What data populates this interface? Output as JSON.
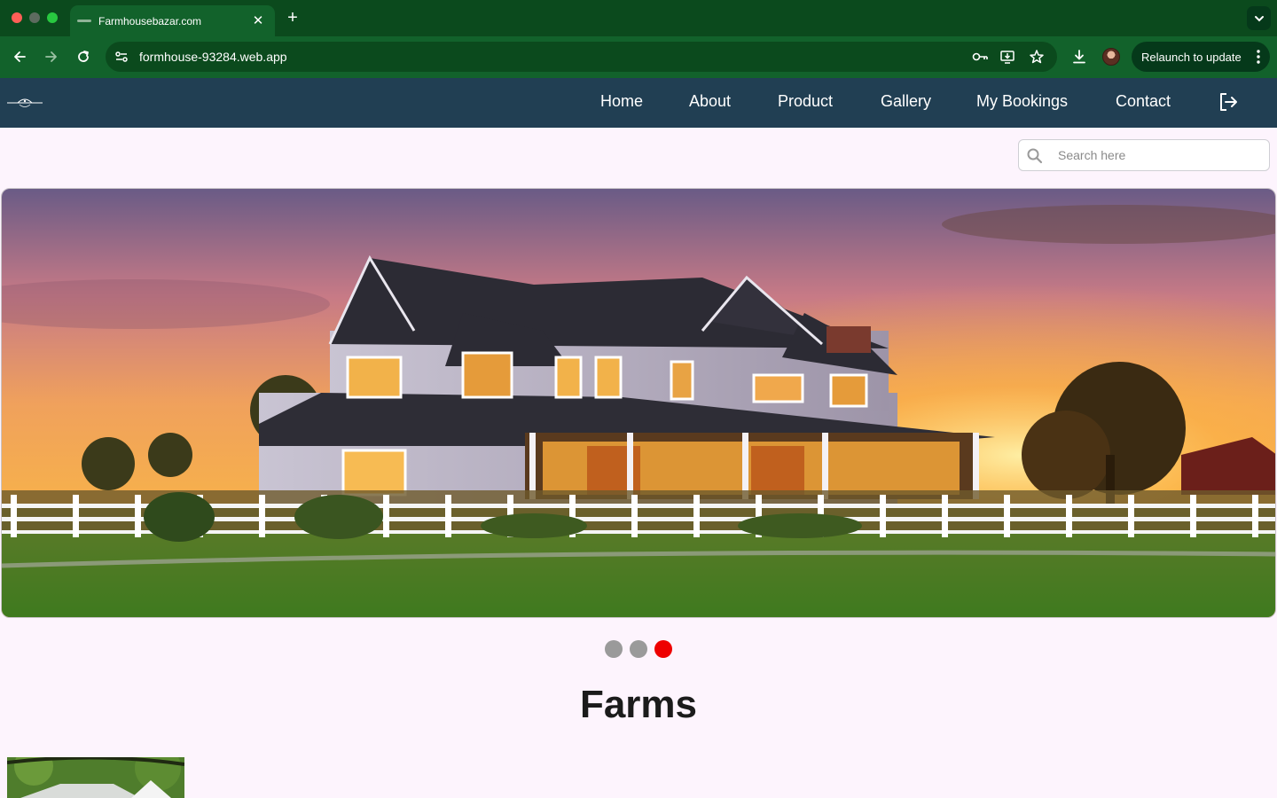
{
  "browser": {
    "tab_title": "Farmhousebazar.com",
    "url": "formhouse-93284.web.app",
    "relaunch_label": "Relaunch to update",
    "colors": {
      "frame": "#0b4a1d",
      "toolbar": "#12622b"
    }
  },
  "nav": {
    "links": [
      "Home",
      "About",
      "Product",
      "Gallery",
      "My Bookings",
      "Contact"
    ],
    "logout_icon": "logout-icon",
    "colors": {
      "background": "#213f53",
      "text": "#ffffff"
    }
  },
  "search": {
    "placeholder": "Search here",
    "value": ""
  },
  "carousel": {
    "slide_count": 3,
    "active_index": 2,
    "active_color": "#ee0000",
    "inactive_color": "#9a9a9a"
  },
  "section": {
    "title": "Farms"
  }
}
